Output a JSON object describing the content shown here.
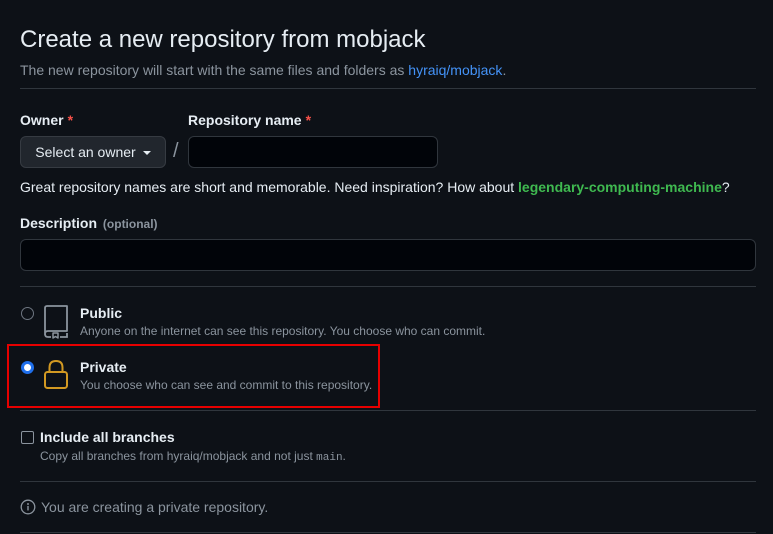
{
  "header": {
    "title": "Create a new repository from mobjack",
    "subtitle_prefix": "The new repository will start with the same files and folders as ",
    "template_link": "hyraiq/mobjack",
    "subtitle_suffix": "."
  },
  "owner": {
    "label": "Owner",
    "required_mark": "*",
    "button_label": "Select an owner"
  },
  "separator": "/",
  "repo_name": {
    "label": "Repository name",
    "required_mark": "*",
    "value": ""
  },
  "hint": {
    "prefix": "Great repository names are short and memorable. Need inspiration? How about ",
    "suggestion": "legendary-computing-machine",
    "suffix": "?"
  },
  "description": {
    "label": "Description",
    "optional": "(optional)",
    "value": ""
  },
  "visibility": {
    "options": [
      {
        "title": "Public",
        "desc": "Anyone on the internet can see this repository. You choose who can commit.",
        "selected": false,
        "icon": "repo-icon"
      },
      {
        "title": "Private",
        "desc": "You choose who can see and commit to this repository.",
        "selected": true,
        "icon": "lock-icon"
      }
    ]
  },
  "branches": {
    "label": "Include all branches",
    "desc_prefix": "Copy all branches from hyraiq/mobjack and not just ",
    "desc_code": "main",
    "desc_suffix": ".",
    "checked": false
  },
  "info": {
    "text": "You are creating a private repository.",
    "icon": "info-icon"
  },
  "colors": {
    "background": "#0d1117",
    "link": "#4493f8",
    "suggestion": "#3fb950",
    "required": "#f85149",
    "highlight": "#e60000",
    "lock": "#d29922"
  }
}
